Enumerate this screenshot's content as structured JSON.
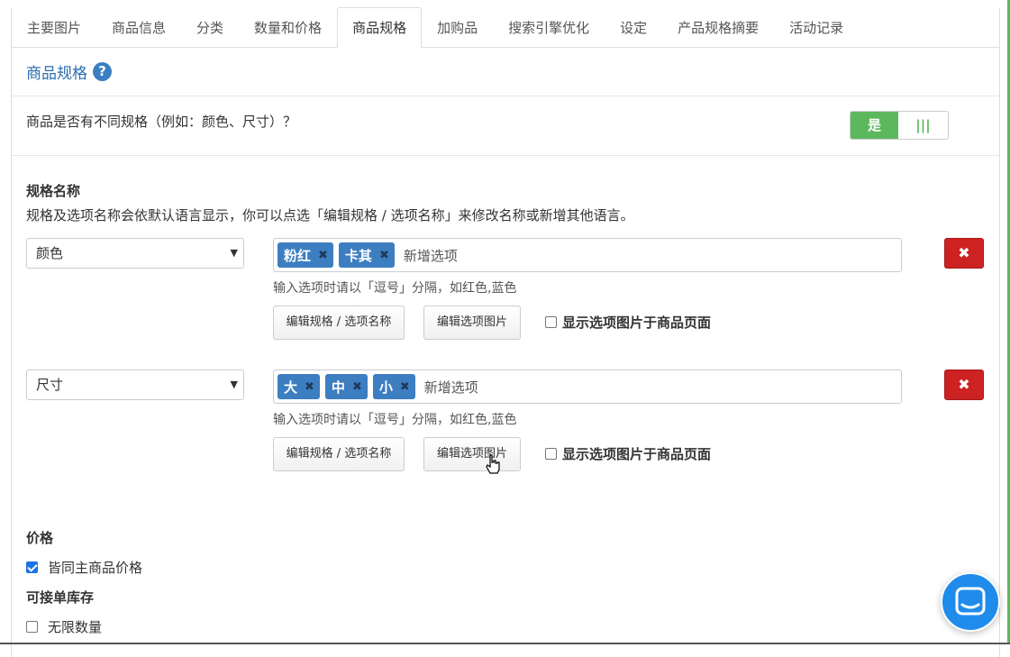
{
  "tabs": [
    "主要图片",
    "商品信息",
    "分类",
    "数量和价格",
    "商品规格",
    "加购品",
    "搜索引擎优化",
    "设定",
    "产品规格摘要",
    "活动记录"
  ],
  "active_tab": "商品规格",
  "section": {
    "title": "商品规格",
    "help_icon": "question-circle-icon"
  },
  "variant_question": "商品是否有不同规格（例如：颜色、尺寸）？",
  "toggle": {
    "yes_label": "是",
    "no_label": "|||"
  },
  "spec_heading": "规格名称",
  "spec_desc": "规格及选项名称会依默认语言显示，你可以点选「编辑规格 / 选项名称」来修改名称或新增其他语言。",
  "specs": [
    {
      "name": "颜色",
      "options": [
        "粉红",
        "卡其"
      ],
      "placeholder": "新增选项",
      "hint": "输入选项时请以「逗号」分隔，如红色,蓝色",
      "edit_names_label": "编辑规格 / 选项名称",
      "edit_images_label": "编辑选项图片",
      "show_images_label": "显示选项图片于商品页面",
      "delete_label": "✖"
    },
    {
      "name": "尺寸",
      "options": [
        "大",
        "中",
        "小"
      ],
      "placeholder": "新增选项",
      "hint": "输入选项时请以「逗号」分隔，如红色,蓝色",
      "edit_names_label": "编辑规格 / 选项名称",
      "edit_images_label": "编辑选项图片",
      "show_images_label": "显示选项图片于商品页面",
      "delete_label": "✖"
    }
  ],
  "price": {
    "heading": "价格",
    "same_price_label": "皆同主商品价格",
    "same_price_checked": true
  },
  "stock": {
    "heading": "可接单库存",
    "unlimited_label": "无限数量",
    "unlimited_checked": false
  },
  "colors": {
    "accent_green": "#5cb85c",
    "link_blue": "#2a6db0",
    "tag_blue": "#3d7ec1",
    "danger_red": "#cc2222",
    "chat_blue": "#1f8ceb"
  }
}
